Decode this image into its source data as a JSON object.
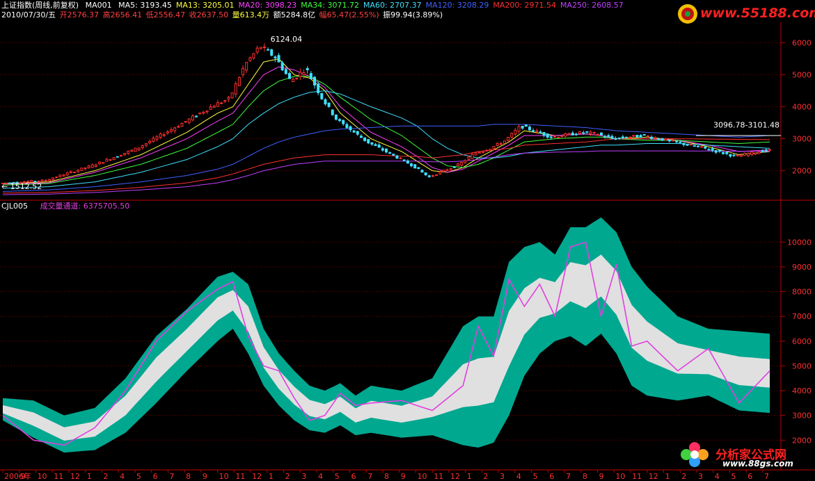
{
  "header": {
    "line1": {
      "title": "上证指数(周线,前复权)",
      "indicator": "MA001",
      "ma_items": [
        {
          "label": "MA5: 3193.45",
          "color": "#ffffff"
        },
        {
          "label": "MA13: 3205.01",
          "color": "#ffff40"
        },
        {
          "label": "MA20: 3098.23",
          "color": "#ff40ff"
        },
        {
          "label": "MA34: 3071.72",
          "color": "#40ff40"
        },
        {
          "label": "MA60: 2707.37",
          "color": "#40e0ff"
        },
        {
          "label": "MA120: 3208.29",
          "color": "#4060ff"
        },
        {
          "label": "MA200: 2971.54",
          "color": "#ff3030"
        },
        {
          "label": "MA250: 2608.57",
          "color": "#c040ff"
        }
      ]
    },
    "line2": {
      "date": "2010/07/30/五",
      "open": "开2576.37",
      "high": "高2656.41",
      "low": "低2556.47",
      "close": "收2637.50",
      "volume": "量613.4万",
      "amount": "额5284.8亿",
      "change": "幅65.47(2.55%)",
      "amplitude": "振99.94(3.89%)"
    }
  },
  "lower_header": {
    "indicator": "CJL005",
    "label": "成交量通道: 6375705.50"
  },
  "annotations": {
    "peak": "6124.04",
    "low": "1512.52",
    "range": "3096.78-3101.48"
  },
  "logos": {
    "top": "www.55188.com",
    "bottom_cn": "分析家公式网",
    "bottom_url": "www.88gs.com"
  },
  "colors": {
    "background": "#000000",
    "grid": "#8b0000",
    "axis": "#c00000",
    "candle_up": "#ff3030",
    "candle_down": "#40e0ff",
    "channel_fill": "#00a890",
    "inner_band": "#e0e0e0",
    "volume_line": "#e040e0",
    "axis_text": "#ff3030",
    "date_text": "#ff3030"
  },
  "chart_data": [
    {
      "type": "line",
      "title": "上证指数(周线,前复权)",
      "x_unit": "month index (0 = 2006-07)",
      "y_axis": {
        "ticks": [
          2000,
          3000,
          4000,
          5000,
          6000
        ],
        "range": [
          1100,
          6600
        ]
      },
      "price": {
        "x": [
          0,
          3,
          6,
          9,
          12,
          14,
          15,
          16,
          17,
          18,
          19,
          20,
          21,
          22,
          24,
          26,
          27,
          28,
          29,
          30,
          31,
          32,
          33,
          34,
          36,
          38,
          39,
          40,
          42,
          44,
          46,
          48,
          50
        ],
        "y": [
          1600,
          1700,
          2150,
          2700,
          3500,
          4050,
          4250,
          5300,
          5900,
          5550,
          4800,
          5200,
          4300,
          3600,
          2900,
          2400,
          2150,
          1800,
          2000,
          2200,
          2550,
          2700,
          2950,
          3400,
          3050,
          3200,
          3150,
          3000,
          3100,
          2900,
          2700,
          2450,
          2637.5
        ]
      },
      "series": [
        {
          "name": "MA13",
          "values_y": [
            1600,
            1650,
            2000,
            2500,
            3200,
            3800,
            4000,
            4700,
            5400,
            5500,
            5000,
            4900,
            4500,
            3800,
            3000,
            2600,
            2300,
            2000,
            1950,
            2100,
            2400,
            2650,
            2900,
            3250,
            3100,
            3150,
            3100,
            3000,
            3050,
            2950,
            2750,
            2500,
            2600
          ]
        },
        {
          "name": "MA20",
          "values_y": [
            1580,
            1620,
            1950,
            2400,
            3000,
            3550,
            3800,
            4400,
            5000,
            5250,
            5150,
            4950,
            4600,
            4000,
            3200,
            2750,
            2450,
            2100,
            1950,
            2050,
            2300,
            2550,
            2800,
            3100,
            3100,
            3150,
            3100,
            3000,
            3000,
            2950,
            2800,
            2600,
            2650
          ]
        },
        {
          "name": "MA34",
          "values_y": [
            1550,
            1600,
            1850,
            2200,
            2700,
            3200,
            3450,
            4000,
            4500,
            4800,
            4950,
            4950,
            4700,
            4300,
            3600,
            3100,
            2750,
            2400,
            2150,
            2100,
            2200,
            2400,
            2650,
            2900,
            3000,
            3050,
            3050,
            3000,
            2950,
            2950,
            2900,
            2850,
            2900
          ]
        },
        {
          "name": "MA60",
          "values_y": [
            1450,
            1500,
            1650,
            1950,
            2350,
            2750,
            3000,
            3450,
            3800,
            4100,
            4300,
            4450,
            4500,
            4400,
            4000,
            3650,
            3400,
            3000,
            2700,
            2500,
            2400,
            2400,
            2450,
            2550,
            2650,
            2750,
            2800,
            2800,
            2850,
            2850,
            2800,
            2750,
            2700
          ]
        },
        {
          "name": "MA120",
          "values_y": [
            1350,
            1400,
            1500,
            1650,
            1850,
            2050,
            2200,
            2450,
            2700,
            2900,
            3050,
            3150,
            3250,
            3300,
            3350,
            3400,
            3400,
            3400,
            3400,
            3400,
            3400,
            3450,
            3450,
            3450,
            3400,
            3350,
            3300,
            3250,
            3200,
            3150,
            3100,
            3050,
            3100
          ]
        },
        {
          "name": "MA200",
          "values_y": [
            1300,
            1320,
            1380,
            1480,
            1620,
            1780,
            1900,
            2050,
            2200,
            2300,
            2400,
            2450,
            2500,
            2500,
            2500,
            2450,
            2450,
            2400,
            2450,
            2500,
            2600,
            2650,
            2700,
            2800,
            2850,
            2900,
            2950,
            3000,
            3000,
            3000,
            2990,
            2980,
            2970
          ]
        },
        {
          "name": "MA250",
          "values_y": [
            1250,
            1270,
            1320,
            1400,
            1500,
            1620,
            1720,
            1850,
            2000,
            2100,
            2200,
            2250,
            2300,
            2300,
            2300,
            2300,
            2300,
            2280,
            2280,
            2300,
            2350,
            2420,
            2500,
            2550,
            2580,
            2600,
            2620,
            2620,
            2620,
            2620,
            2615,
            2610,
            2608
          ]
        }
      ]
    },
    {
      "type": "area",
      "title": "CJL005",
      "y_axis": {
        "ticks": [
          2000,
          3000,
          4000,
          5000,
          6000,
          7000,
          8000,
          9000,
          10000
        ],
        "range": [
          800,
          11300
        ]
      },
      "x": [
        0,
        2,
        4,
        6,
        8,
        10,
        12,
        14,
        15,
        16,
        17,
        18,
        19,
        20,
        21,
        22,
        23,
        24,
        26,
        28,
        30,
        31,
        32,
        33,
        34,
        35,
        36,
        37,
        38,
        39,
        40,
        41,
        42,
        44,
        46,
        48,
        50
      ],
      "series": [
        {
          "name": "upper",
          "values": [
            3700,
            3600,
            3000,
            3300,
            4500,
            6200,
            7300,
            8600,
            8800,
            8300,
            6500,
            5500,
            4800,
            4200,
            4000,
            4300,
            3800,
            4200,
            4000,
            4500,
            6600,
            7000,
            7000,
            9200,
            9800,
            10000,
            9500,
            10600,
            10600,
            11000,
            10400,
            9000,
            8200,
            7000,
            6500,
            6400,
            6300
          ]
        },
        {
          "name": "lower",
          "values": [
            2800,
            2100,
            1500,
            1600,
            2300,
            3500,
            4800,
            6000,
            6500,
            5500,
            4200,
            3400,
            2800,
            2400,
            2300,
            2600,
            2200,
            2300,
            2100,
            2200,
            1800,
            1700,
            1900,
            3000,
            4600,
            5500,
            6000,
            6200,
            5800,
            6300,
            5500,
            4200,
            3800,
            3600,
            3800,
            3200,
            3100
          ]
        },
        {
          "name": "成交量通道",
          "values": [
            3000,
            2000,
            1800,
            2500,
            4000,
            6000,
            7200,
            8100,
            8400,
            6200,
            5000,
            4800,
            3700,
            2800,
            3000,
            3900,
            3400,
            3500,
            3600,
            3200,
            4200,
            6600,
            5400,
            8500,
            7400,
            8300,
            7000,
            9800,
            10000,
            7000,
            9100,
            5800,
            6000,
            4800,
            5700,
            3500,
            4800
          ]
        }
      ]
    }
  ],
  "x_axis": {
    "labels": [
      "2006年",
      "9",
      "10",
      "11",
      "12",
      "1",
      "2",
      "4",
      "5",
      "6",
      "7",
      "8",
      "9",
      "10",
      "11",
      "12",
      "1",
      "2",
      "3",
      "4",
      "5",
      "6",
      "7",
      "8",
      "9",
      "10",
      "11",
      "12",
      "1",
      "2",
      "3",
      "4",
      "5",
      "6",
      "7",
      "8",
      "9",
      "10",
      "11",
      "12",
      "1",
      "2",
      "3",
      "4",
      "5",
      "6",
      "7"
    ]
  }
}
